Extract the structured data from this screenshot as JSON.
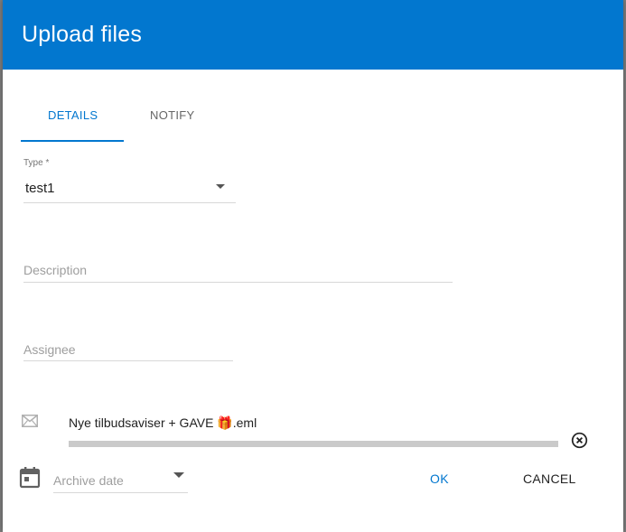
{
  "dialog": {
    "title": "Upload files",
    "header_color": "#0277cf"
  },
  "tabs": [
    {
      "label": "DETAILS",
      "active": true
    },
    {
      "label": "NOTIFY",
      "active": false
    }
  ],
  "form": {
    "type": {
      "label": "Type *",
      "value": "test1"
    },
    "description": {
      "placeholder": "Description",
      "value": ""
    },
    "assignee": {
      "placeholder": "Assignee",
      "value": ""
    },
    "archive_date": {
      "placeholder": "Archive date",
      "value": ""
    }
  },
  "attachment": {
    "name": "Nye tilbudsaviser + GAVE",
    "emoji": "🎁",
    "extension": ".eml",
    "upload_progress": 1.0
  },
  "icons": {
    "attachment": "mail-icon",
    "remove": "remove-circle-icon",
    "date": "calendar-icon"
  },
  "actions": {
    "ok_label": "OK",
    "cancel_label": "CANCEL"
  }
}
